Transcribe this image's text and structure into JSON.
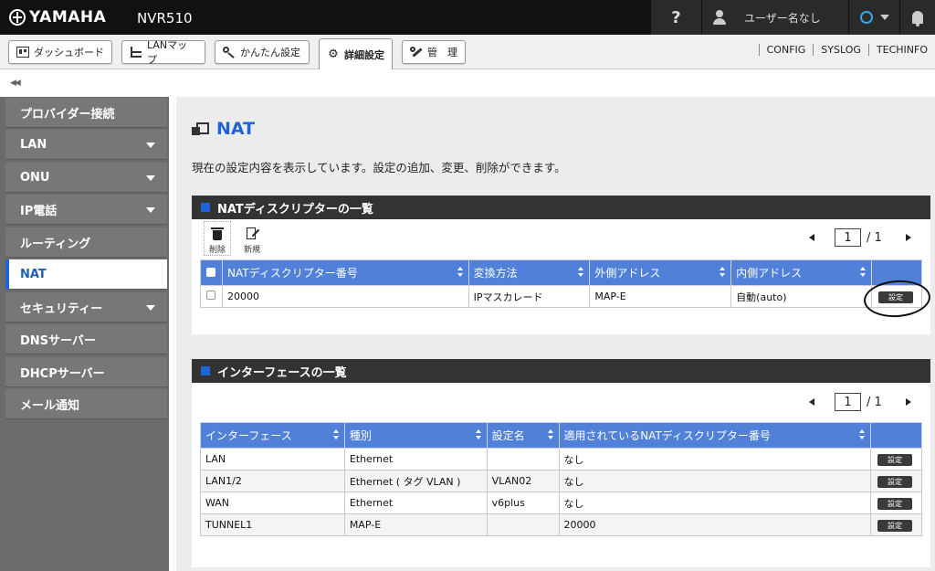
{
  "header": {
    "logo": "YAMAHA",
    "model": "NVR510",
    "help": "?",
    "user": "ユーザー名なし"
  },
  "tabs": [
    {
      "label": "ダッシュボード"
    },
    {
      "label": "LANマップ"
    },
    {
      "label": "かんたん設定"
    },
    {
      "label": "詳細設定"
    },
    {
      "label": "管　理"
    }
  ],
  "right_links": [
    "CONFIG",
    "SYSLOG",
    "TECHINFO"
  ],
  "sidebar": {
    "items": [
      {
        "label": "プロバイダー接続",
        "arrow": false
      },
      {
        "label": "LAN",
        "arrow": true
      },
      {
        "label": "ONU",
        "arrow": true
      },
      {
        "label": "IP電話",
        "arrow": true
      },
      {
        "label": "ルーティング",
        "arrow": false
      },
      {
        "label": "NAT",
        "arrow": false,
        "active": true
      },
      {
        "label": "セキュリティー",
        "arrow": true
      },
      {
        "label": "DNSサーバー",
        "arrow": false
      },
      {
        "label": "DHCPサーバー",
        "arrow": false
      },
      {
        "label": "メール通知",
        "arrow": false
      }
    ]
  },
  "page": {
    "title": "NAT",
    "description": "現在の設定内容を表示しています。設定の追加、変更、削除ができます。"
  },
  "nat_panel": {
    "title": "NATディスクリプターの一覧",
    "delete_label": "削除",
    "new_label": "新規",
    "pager": {
      "current": "1",
      "total": "/ 1"
    },
    "columns": [
      "NATディスクリプター番号",
      "変換方法",
      "外側アドレス",
      "内側アドレス"
    ],
    "rows": [
      {
        "num": "20000",
        "method": "IPマスカレード",
        "outer": "MAP-E",
        "inner": "自動(auto)",
        "button": "設定"
      }
    ]
  },
  "if_panel": {
    "title": "インターフェースの一覧",
    "pager": {
      "current": "1",
      "total": "/ 1"
    },
    "columns": [
      "インターフェース",
      "種別",
      "設定名",
      "適用されているNATディスクリプター番号"
    ],
    "rows": [
      {
        "iface": "LAN",
        "type": "Ethernet",
        "name": "",
        "nat": "なし",
        "button": "設定"
      },
      {
        "iface": "LAN1/2",
        "type": "Ethernet ( タグ VLAN )",
        "name": "VLAN02",
        "nat": "なし",
        "button": "設定"
      },
      {
        "iface": "WAN",
        "type": "Ethernet",
        "name": "v6plus",
        "nat": "なし",
        "button": "設定"
      },
      {
        "iface": "TUNNEL1",
        "type": "MAP-E",
        "name": "",
        "nat": "20000",
        "button": "設定"
      }
    ]
  },
  "colors": {
    "accent": "#1f64d6",
    "table_header": "#5080d8",
    "sidebar": "#777777",
    "topbar": "#111111"
  }
}
